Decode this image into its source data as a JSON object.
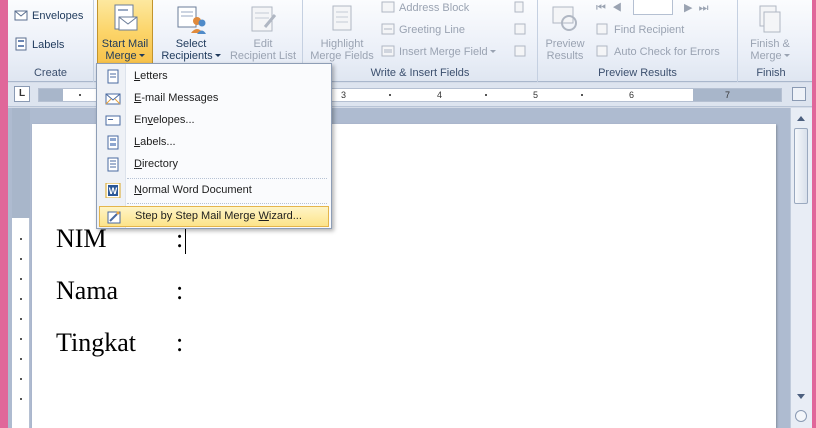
{
  "ribbon": {
    "groups": {
      "create": {
        "label": "Create",
        "envelopes": "Envelopes",
        "labels": "Labels"
      },
      "start": {
        "start_mail_merge_line1": "Start Mail",
        "start_mail_merge_line2": "Merge",
        "select_recipients_line1": "Select",
        "select_recipients_line2": "Recipients",
        "edit_list_line1": "Edit",
        "edit_list_line2": "Recipient List"
      },
      "write": {
        "label": "Write & Insert Fields",
        "highlight_line1": "Highlight",
        "highlight_line2": "Merge Fields",
        "address_block": "Address Block",
        "greeting_line": "Greeting Line",
        "insert_merge_field": "Insert Merge Field"
      },
      "preview": {
        "label": "Preview Results",
        "preview_line1": "Preview",
        "preview_line2": "Results",
        "find_recipient": "Find Recipient",
        "auto_check": "Auto Check for Errors"
      },
      "finish": {
        "label": "Finish",
        "finish_line1": "Finish &",
        "finish_line2": "Merge"
      }
    }
  },
  "ruler": {
    "tab_selector": "L",
    "ticks": [
      "3",
      "4",
      "5",
      "6",
      "7"
    ]
  },
  "menu": {
    "items": [
      {
        "pre": "",
        "key": "L",
        "post": "etters"
      },
      {
        "pre": "",
        "key": "E",
        "post": "-mail Messages"
      },
      {
        "pre": "En",
        "key": "v",
        "post": "elopes..."
      },
      {
        "pre": "",
        "key": "L",
        "post": "abels..."
      },
      {
        "pre": "",
        "key": "D",
        "post": "irectory"
      },
      {
        "pre": "",
        "key": "N",
        "post": "ormal Word Document"
      },
      {
        "pre": "Step by Step Mail Merge ",
        "key": "W",
        "post": "izard..."
      }
    ]
  },
  "document": {
    "lines": [
      {
        "label": "NIM",
        "colon": ":"
      },
      {
        "label": "Nama",
        "colon": ":"
      },
      {
        "label": "Tingkat",
        "colon": ":"
      }
    ]
  },
  "colors": {
    "frame": "#e0679a",
    "active_button": "#fcd56a",
    "menu_highlight": "#fde48a"
  }
}
